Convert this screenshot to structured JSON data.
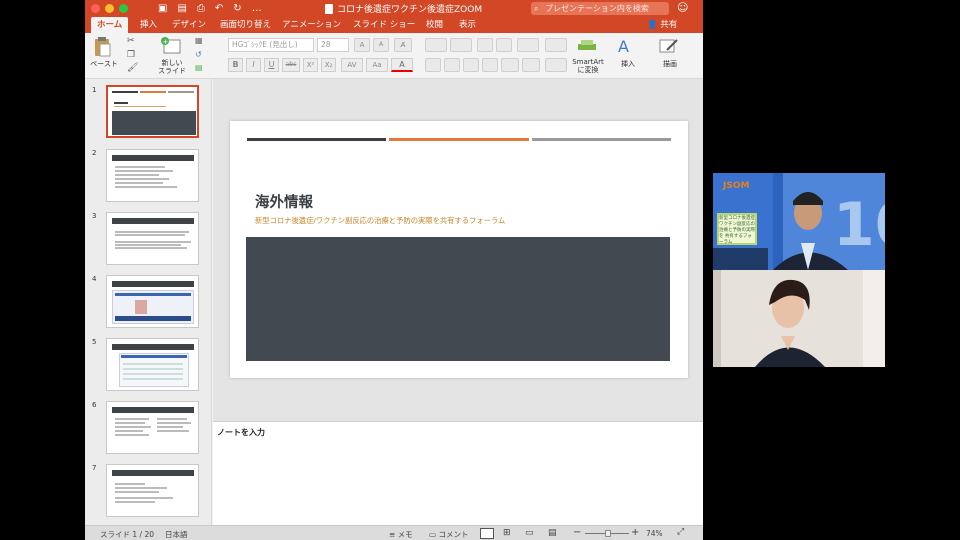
{
  "window": {
    "title": "コロナ後遺症ワクチン後遺症ZOOM",
    "search_placeholder": "プレゼンテーション内を検索",
    "share_label": "共有"
  },
  "tabs": [
    {
      "label": "ホーム",
      "active": true
    },
    {
      "label": "挿入"
    },
    {
      "label": "デザイン"
    },
    {
      "label": "画面切り替え"
    },
    {
      "label": "アニメーション"
    },
    {
      "label": "スライド ショー"
    },
    {
      "label": "校閲"
    },
    {
      "label": "表示"
    }
  ],
  "ribbon": {
    "paste_label": "ペースト",
    "new_slide_label_1": "新しい",
    "new_slide_label_2": "スライド",
    "font_name": "HGｺﾞｼｯｸE (見出し)",
    "font_size": "28",
    "smartart_label_1": "SmartArt",
    "smartart_label_2": "に変換",
    "insert_label": "挿入",
    "draw_label": "描画",
    "format_buttons": [
      "B",
      "I",
      "U",
      "abc",
      "X²",
      "X₂"
    ]
  },
  "slides_panel": [
    {
      "num": "1"
    },
    {
      "num": "2"
    },
    {
      "num": "3"
    },
    {
      "num": "4"
    },
    {
      "num": "5"
    },
    {
      "num": "6"
    },
    {
      "num": "7"
    }
  ],
  "slide": {
    "title": "海外情報",
    "subtitle": "新型コロナ後遺症/ワクチン副反応の治療と予防の実際を共有するフォーラム",
    "accent_colors": [
      "#3b3f44",
      "#e07b39",
      "#9a9a9a"
    ]
  },
  "notes": {
    "placeholder": "ノートを入力"
  },
  "statusbar": {
    "slide_info": "スライド 1 / 20",
    "language": "日本語",
    "notes_label": "メモ",
    "comments_label": "コメント",
    "zoom": "74%"
  },
  "video": {
    "logo_text": "JSOM",
    "sign_text": "新型コロナ後遺症 ワクチン副反応の 治療と予防の実際を 共有するフォーラム"
  },
  "colors": {
    "ppt_orange": "#d24726",
    "slide_dark": "#424950"
  }
}
